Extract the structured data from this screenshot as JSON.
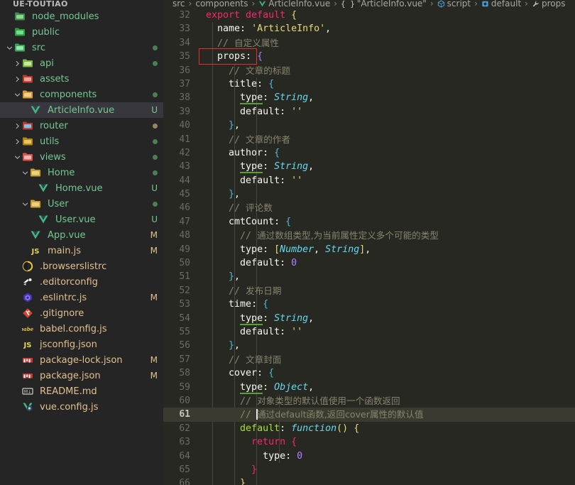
{
  "window": {
    "title": "UE-TOUTIAO"
  },
  "sidebar": {
    "items": [
      {
        "label": "node_modules",
        "icon": "folder-node-modules-icon",
        "indent": 0,
        "twisty": "",
        "badge": "",
        "badge_color": "",
        "dot": "",
        "selected": false
      },
      {
        "label": "public",
        "icon": "folder-public-icon",
        "indent": 0,
        "twisty": "",
        "badge": "",
        "badge_color": "",
        "dot": "",
        "selected": false
      },
      {
        "label": "src",
        "icon": "folder-src-icon",
        "indent": 0,
        "twisty": "down",
        "badge": "",
        "badge_color": "",
        "dot": "green",
        "selected": false
      },
      {
        "label": "api",
        "icon": "folder-api-icon",
        "indent": 1,
        "twisty": "right",
        "badge": "",
        "badge_color": "",
        "dot": "green",
        "selected": false
      },
      {
        "label": "assets",
        "icon": "folder-assets-icon",
        "indent": 1,
        "twisty": "right",
        "badge": "",
        "badge_color": "",
        "dot": "",
        "selected": false
      },
      {
        "label": "components",
        "icon": "folder-components-icon",
        "indent": 1,
        "twisty": "down",
        "badge": "",
        "badge_color": "",
        "dot": "green",
        "selected": false
      },
      {
        "label": "ArticleInfo.vue",
        "icon": "vue-file-icon",
        "indent": 2,
        "twisty": "",
        "badge": "U",
        "badge_color": "green",
        "dot": "",
        "selected": true
      },
      {
        "label": "router",
        "icon": "folder-router-icon",
        "indent": 1,
        "twisty": "right",
        "badge": "",
        "badge_color": "",
        "dot": "tan",
        "selected": false
      },
      {
        "label": "utils",
        "icon": "folder-utils-icon",
        "indent": 1,
        "twisty": "right",
        "badge": "",
        "badge_color": "",
        "dot": "green",
        "selected": false
      },
      {
        "label": "views",
        "icon": "folder-views-icon",
        "indent": 1,
        "twisty": "down",
        "badge": "",
        "badge_color": "",
        "dot": "green",
        "selected": false
      },
      {
        "label": "Home",
        "icon": "folder-plain-icon",
        "indent": 2,
        "twisty": "down",
        "badge": "",
        "badge_color": "",
        "dot": "green",
        "selected": false
      },
      {
        "label": "Home.vue",
        "icon": "vue-file-icon",
        "indent": 3,
        "twisty": "",
        "badge": "U",
        "badge_color": "green",
        "dot": "",
        "selected": false
      },
      {
        "label": "User",
        "icon": "folder-plain-icon",
        "indent": 2,
        "twisty": "down",
        "badge": "",
        "badge_color": "",
        "dot": "green",
        "selected": false
      },
      {
        "label": "User.vue",
        "icon": "vue-file-icon",
        "indent": 3,
        "twisty": "",
        "badge": "U",
        "badge_color": "green",
        "dot": "",
        "selected": false
      },
      {
        "label": "App.vue",
        "icon": "vue-file-icon",
        "indent": 2,
        "twisty": "",
        "badge": "M",
        "badge_color": "orange",
        "dot": "",
        "selected": false
      },
      {
        "label": "main.js",
        "icon": "js-file-icon",
        "indent": 2,
        "twisty": "",
        "badge": "M",
        "badge_color": "orange",
        "dot": "",
        "selected": false
      },
      {
        "label": ".browserslistrc",
        "icon": "browserslist-icon",
        "indent": 1,
        "twisty": "",
        "badge": "",
        "badge_color": "",
        "dot": "",
        "selected": false
      },
      {
        "label": ".editorconfig",
        "icon": "editorconfig-icon",
        "indent": 1,
        "twisty": "",
        "badge": "",
        "badge_color": "",
        "dot": "",
        "selected": false
      },
      {
        "label": ".eslintrc.js",
        "icon": "eslint-icon",
        "indent": 1,
        "twisty": "",
        "badge": "M",
        "badge_color": "orange",
        "dot": "",
        "selected": false
      },
      {
        "label": ".gitignore",
        "icon": "git-icon",
        "indent": 1,
        "twisty": "",
        "badge": "",
        "badge_color": "",
        "dot": "",
        "selected": false
      },
      {
        "label": "babel.config.js",
        "icon": "babel-icon",
        "indent": 1,
        "twisty": "",
        "badge": "",
        "badge_color": "",
        "dot": "",
        "selected": false
      },
      {
        "label": "jsconfig.json",
        "icon": "js-file-icon",
        "indent": 1,
        "twisty": "",
        "badge": "",
        "badge_color": "",
        "dot": "",
        "selected": false
      },
      {
        "label": "package-lock.json",
        "icon": "npm-icon",
        "indent": 1,
        "twisty": "",
        "badge": "M",
        "badge_color": "orange",
        "dot": "",
        "selected": false
      },
      {
        "label": "package.json",
        "icon": "npm-icon",
        "indent": 1,
        "twisty": "",
        "badge": "M",
        "badge_color": "orange",
        "dot": "",
        "selected": false
      },
      {
        "label": "README.md",
        "icon": "markdown-icon",
        "indent": 1,
        "twisty": "",
        "badge": "",
        "badge_color": "",
        "dot": "",
        "selected": false
      },
      {
        "label": "vue.config.js",
        "icon": "vue-config-icon",
        "indent": 1,
        "twisty": "",
        "badge": "",
        "badge_color": "",
        "dot": "",
        "selected": false
      }
    ]
  },
  "breadcrumb": {
    "items": [
      {
        "label": "src",
        "icon": ""
      },
      {
        "label": "components",
        "icon": ""
      },
      {
        "label": "ArticleInfo.vue",
        "icon": "vue-file-icon"
      },
      {
        "label": "\"ArticleInfo.vue\"",
        "icon": "braces-icon"
      },
      {
        "label": "script",
        "icon": "module-icon"
      },
      {
        "label": "default",
        "icon": "object-icon"
      },
      {
        "label": "props",
        "icon": "wrench-icon"
      }
    ],
    "separator": "›"
  },
  "editor": {
    "first_line_number": 32,
    "active_line_number": 61,
    "annotation_box_target": "props",
    "annotation_box_color": "#e03030",
    "lines": [
      {
        "n": 32,
        "tokens": [
          {
            "t": "export ",
            "c": "kw"
          },
          {
            "t": "default ",
            "c": "kw"
          },
          {
            "t": "{",
            "c": "br-y"
          }
        ]
      },
      {
        "n": 33,
        "tokens": [
          {
            "t": "  ",
            "c": "op"
          },
          {
            "t": "name",
            "c": "ident"
          },
          {
            "t": ": ",
            "c": "op"
          },
          {
            "t": "'ArticleInfo'",
            "c": "yellowb"
          },
          {
            "t": ",",
            "c": "op"
          }
        ]
      },
      {
        "n": 34,
        "tokens": [
          {
            "t": "  // ",
            "c": "cmt"
          },
          {
            "t": "自定义属性",
            "c": "cmt cn"
          }
        ]
      },
      {
        "n": 35,
        "tokens": [
          {
            "t": "  ",
            "c": "op"
          },
          {
            "t": "props",
            "c": "ident"
          },
          {
            "t": ":",
            "c": "op"
          },
          {
            "t": " ",
            "c": "op"
          },
          {
            "t": "{",
            "c": "br-p"
          }
        ]
      },
      {
        "n": 36,
        "tokens": [
          {
            "t": "    // ",
            "c": "cmt"
          },
          {
            "t": "文章的标题",
            "c": "cmt cn"
          }
        ]
      },
      {
        "n": 37,
        "tokens": [
          {
            "t": "    ",
            "c": "op"
          },
          {
            "t": "title",
            "c": "ident"
          },
          {
            "t": ": ",
            "c": "op"
          },
          {
            "t": "{",
            "c": "br-b"
          }
        ]
      },
      {
        "n": 38,
        "tokens": [
          {
            "t": "      ",
            "c": "op"
          },
          {
            "t": "type",
            "c": "ident spell"
          },
          {
            "t": ": ",
            "c": "op"
          },
          {
            "t": "String",
            "c": "type"
          },
          {
            "t": ",",
            "c": "op"
          }
        ]
      },
      {
        "n": 39,
        "tokens": [
          {
            "t": "      ",
            "c": "op"
          },
          {
            "t": "default",
            "c": "ident"
          },
          {
            "t": ": ",
            "c": "op"
          },
          {
            "t": "''",
            "c": "yellowb"
          }
        ]
      },
      {
        "n": 40,
        "tokens": [
          {
            "t": "    ",
            "c": "op"
          },
          {
            "t": "}",
            "c": "br-b"
          },
          {
            "t": ",",
            "c": "op"
          }
        ]
      },
      {
        "n": 41,
        "tokens": [
          {
            "t": "    // ",
            "c": "cmt"
          },
          {
            "t": "文章的作者",
            "c": "cmt cn"
          }
        ]
      },
      {
        "n": 42,
        "tokens": [
          {
            "t": "    ",
            "c": "op"
          },
          {
            "t": "author",
            "c": "ident"
          },
          {
            "t": ": ",
            "c": "op"
          },
          {
            "t": "{",
            "c": "br-b"
          }
        ]
      },
      {
        "n": 43,
        "tokens": [
          {
            "t": "      ",
            "c": "op"
          },
          {
            "t": "type",
            "c": "ident spell"
          },
          {
            "t": ": ",
            "c": "op"
          },
          {
            "t": "String",
            "c": "type"
          },
          {
            "t": ",",
            "c": "op"
          }
        ]
      },
      {
        "n": 44,
        "tokens": [
          {
            "t": "      ",
            "c": "op"
          },
          {
            "t": "default",
            "c": "ident"
          },
          {
            "t": ": ",
            "c": "op"
          },
          {
            "t": "''",
            "c": "yellowb"
          }
        ]
      },
      {
        "n": 45,
        "tokens": [
          {
            "t": "    ",
            "c": "op"
          },
          {
            "t": "}",
            "c": "br-b"
          },
          {
            "t": ",",
            "c": "op"
          }
        ]
      },
      {
        "n": 46,
        "tokens": [
          {
            "t": "    // ",
            "c": "cmt"
          },
          {
            "t": "评论数",
            "c": "cmt cn"
          }
        ]
      },
      {
        "n": 47,
        "tokens": [
          {
            "t": "    ",
            "c": "op"
          },
          {
            "t": "cmtCount",
            "c": "ident"
          },
          {
            "t": ": ",
            "c": "op"
          },
          {
            "t": "{",
            "c": "br-b"
          }
        ]
      },
      {
        "n": 48,
        "tokens": [
          {
            "t": "      // ",
            "c": "cmt"
          },
          {
            "t": "通过数组类型,为当前属性定义多个可能的类型",
            "c": "cmt cn"
          }
        ]
      },
      {
        "n": 49,
        "tokens": [
          {
            "t": "      ",
            "c": "op"
          },
          {
            "t": "type",
            "c": "ident"
          },
          {
            "t": ": ",
            "c": "op"
          },
          {
            "t": "[",
            "c": "br-y"
          },
          {
            "t": "Number",
            "c": "type"
          },
          {
            "t": ", ",
            "c": "op"
          },
          {
            "t": "String",
            "c": "type"
          },
          {
            "t": "]",
            "c": "br-y"
          },
          {
            "t": ",",
            "c": "op"
          }
        ]
      },
      {
        "n": 50,
        "tokens": [
          {
            "t": "      ",
            "c": "op"
          },
          {
            "t": "default",
            "c": "ident"
          },
          {
            "t": ": ",
            "c": "op"
          },
          {
            "t": "0",
            "c": "num"
          }
        ]
      },
      {
        "n": 51,
        "tokens": [
          {
            "t": "    ",
            "c": "op"
          },
          {
            "t": "}",
            "c": "br-b"
          },
          {
            "t": ",",
            "c": "op"
          }
        ]
      },
      {
        "n": 52,
        "tokens": [
          {
            "t": "    // ",
            "c": "cmt"
          },
          {
            "t": "发布日期",
            "c": "cmt cn"
          }
        ]
      },
      {
        "n": 53,
        "tokens": [
          {
            "t": "    ",
            "c": "op"
          },
          {
            "t": "time",
            "c": "ident"
          },
          {
            "t": ": ",
            "c": "op"
          },
          {
            "t": "{",
            "c": "br-b"
          }
        ]
      },
      {
        "n": 54,
        "tokens": [
          {
            "t": "      ",
            "c": "op"
          },
          {
            "t": "type",
            "c": "ident spell"
          },
          {
            "t": ": ",
            "c": "op"
          },
          {
            "t": "String",
            "c": "type"
          },
          {
            "t": ",",
            "c": "op"
          }
        ]
      },
      {
        "n": 55,
        "tokens": [
          {
            "t": "      ",
            "c": "op"
          },
          {
            "t": "default",
            "c": "ident"
          },
          {
            "t": ": ",
            "c": "op"
          },
          {
            "t": "''",
            "c": "yellowb"
          }
        ]
      },
      {
        "n": 56,
        "tokens": [
          {
            "t": "    ",
            "c": "op"
          },
          {
            "t": "}",
            "c": "br-b"
          },
          {
            "t": ",",
            "c": "op"
          }
        ]
      },
      {
        "n": 57,
        "tokens": [
          {
            "t": "    // ",
            "c": "cmt"
          },
          {
            "t": "文章封面",
            "c": "cmt cn"
          }
        ]
      },
      {
        "n": 58,
        "tokens": [
          {
            "t": "    ",
            "c": "op"
          },
          {
            "t": "cover",
            "c": "ident"
          },
          {
            "t": ": ",
            "c": "op"
          },
          {
            "t": "{",
            "c": "br-b"
          }
        ]
      },
      {
        "n": 59,
        "tokens": [
          {
            "t": "      ",
            "c": "op"
          },
          {
            "t": "type",
            "c": "ident spell"
          },
          {
            "t": ": ",
            "c": "op"
          },
          {
            "t": "Object",
            "c": "type"
          },
          {
            "t": ",",
            "c": "op"
          }
        ]
      },
      {
        "n": 60,
        "tokens": [
          {
            "t": "      // ",
            "c": "cmt"
          },
          {
            "t": "对象类型的默认值使用一个函数返回",
            "c": "cmt cn"
          }
        ]
      },
      {
        "n": 61,
        "tokens": [
          {
            "t": "      // ",
            "c": "cmt"
          },
          {
            "t": "@caret@",
            "c": "caret"
          },
          {
            "t": "通过default函数,返回cover属性的默认值",
            "c": "cmt cn"
          }
        ]
      },
      {
        "n": 62,
        "tokens": [
          {
            "t": "      ",
            "c": "op"
          },
          {
            "t": "default",
            "c": "func"
          },
          {
            "t": ": ",
            "c": "op"
          },
          {
            "t": "function",
            "c": "type"
          },
          {
            "t": "(",
            "c": "br-y"
          },
          {
            "t": ")",
            "c": "br-y"
          },
          {
            "t": " ",
            "c": "op"
          },
          {
            "t": "{",
            "c": "br-y"
          }
        ]
      },
      {
        "n": 63,
        "tokens": [
          {
            "t": "        ",
            "c": "op"
          },
          {
            "t": "return",
            "c": "kw"
          },
          {
            "t": " ",
            "c": "op"
          },
          {
            "t": "{",
            "c": "br-pk"
          }
        ]
      },
      {
        "n": 64,
        "tokens": [
          {
            "t": "          ",
            "c": "op"
          },
          {
            "t": "type",
            "c": "ident"
          },
          {
            "t": ": ",
            "c": "op"
          },
          {
            "t": "0",
            "c": "num"
          }
        ]
      },
      {
        "n": 65,
        "tokens": [
          {
            "t": "        ",
            "c": "op"
          },
          {
            "t": "}",
            "c": "br-pk"
          }
        ]
      },
      {
        "n": 66,
        "tokens": [
          {
            "t": "      ",
            "c": "op"
          },
          {
            "t": "}",
            "c": "br-y"
          }
        ]
      }
    ]
  }
}
